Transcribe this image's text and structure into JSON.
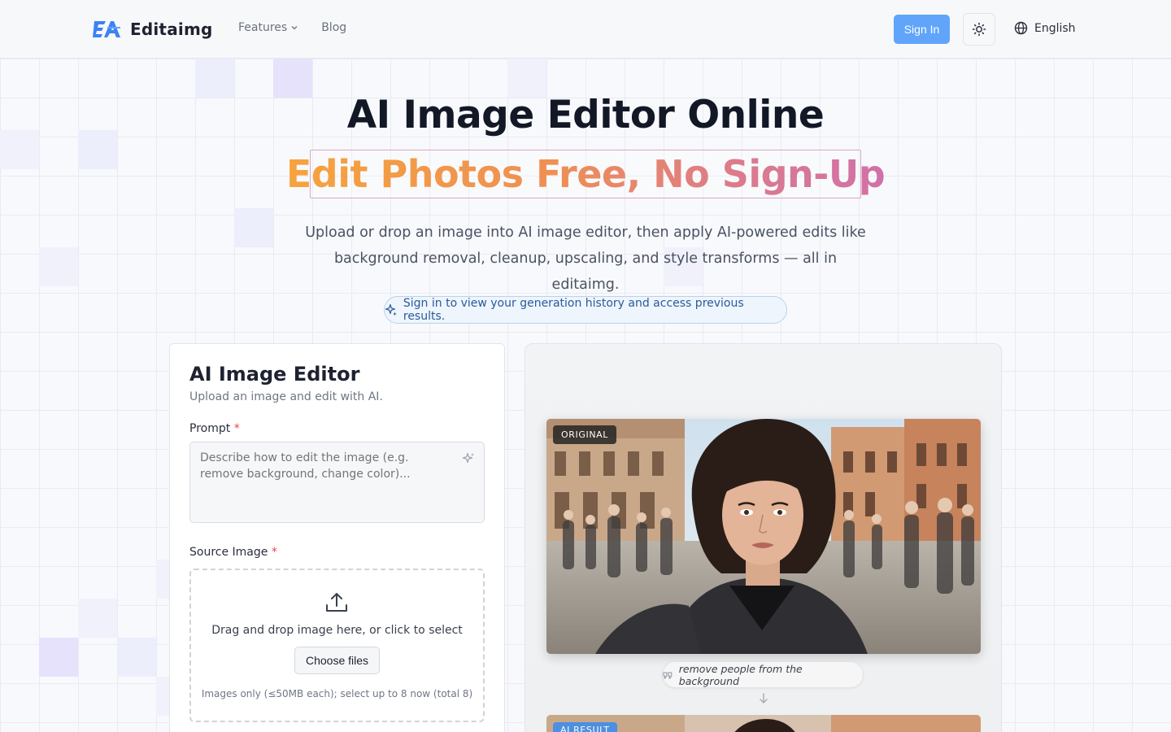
{
  "header": {
    "logo_text": "Editaimg",
    "nav": [
      {
        "label": "Features",
        "has_dropdown": true
      },
      {
        "label": "Blog",
        "has_dropdown": false
      }
    ],
    "signin_label": "Sign In",
    "theme_icon": "sun-icon",
    "language_label": "English",
    "accent_color": "#60a5fa"
  },
  "hero": {
    "title": "AI Image Editor Online",
    "subtitle": "Edit Photos Free, No Sign-Up",
    "description": "Upload or drop an image into AI image editor, then apply AI-powered edits like background removal, cleanup, upscaling, and style transforms — all in editaimg.",
    "notice": "Sign in to view your generation history and access previous results."
  },
  "editor": {
    "title": "AI Image Editor",
    "subtitle": "Upload an image and edit with AI.",
    "prompt_label": "Prompt",
    "prompt_placeholder": "Describe how to edit the image (e.g. remove background, change color)...",
    "prompt_value": "",
    "source_label": "Source Image",
    "required_mark": "*",
    "drop_text": "Drag and drop image here, or click to select",
    "choose_button": "Choose files",
    "drop_hint": "Images only (≤50MB each); select up to 8 now (total 8)"
  },
  "preview": {
    "original_badge": "ORIGINAL",
    "example_prompt": "remove people from the background",
    "result_badge": "AI RESULT"
  }
}
